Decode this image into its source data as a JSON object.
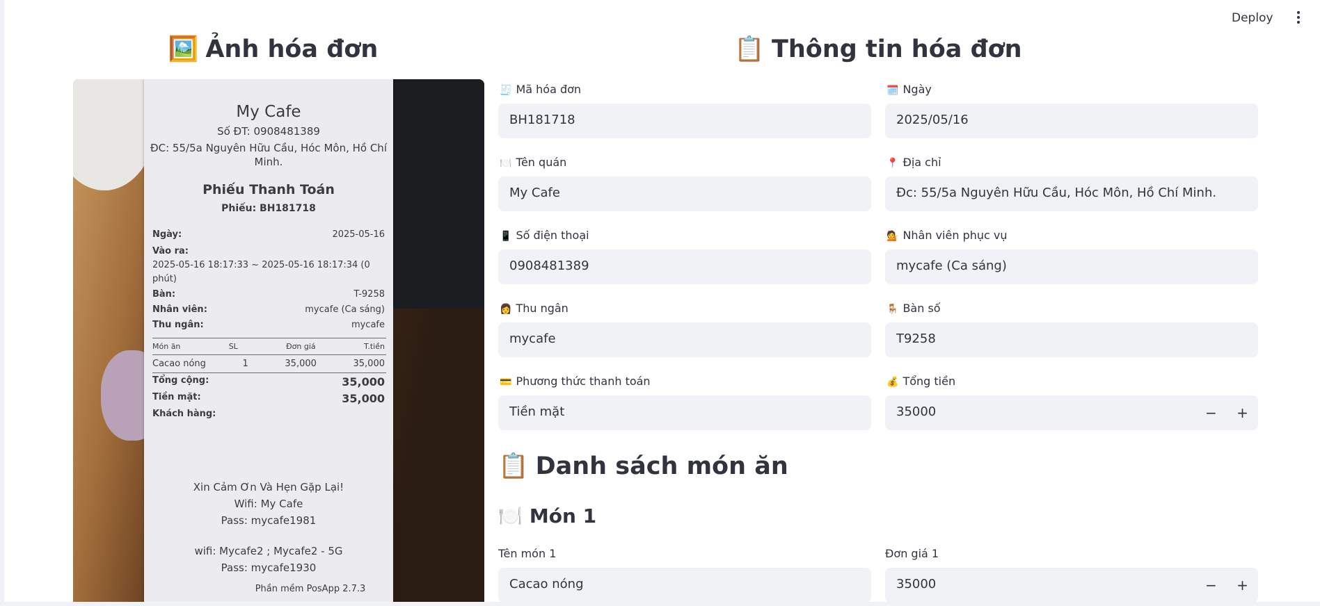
{
  "topbar": {
    "deploy_label": "Deploy",
    "menu_icon": "more-vertical-icon"
  },
  "left": {
    "heading_emoji": "🖼️",
    "heading": "Ảnh hóa đơn",
    "receipt": {
      "shop": "My Cafe",
      "phone": "Số ĐT: 0908481389",
      "address_1": "ĐC: 55/5a Nguyên Hữu Cầu, Hóc Môn, Hồ Chí",
      "address_2": "Minh.",
      "title": "Phiếu Thanh Toán",
      "code": "Phiếu: BH181718",
      "date_label": "Ngày:",
      "date_value": "2025-05-16",
      "inout_label": "Vào ra:",
      "inout_1": "2025-05-16 18:17:33 ~ 2025-05-16 18:17:34 (0",
      "inout_2": "phút)",
      "table_label": "Bàn:",
      "table_value": "T-9258",
      "staff_label": "Nhân viên:",
      "staff_value": "mycafe (Ca sáng)",
      "cashier_label": "Thu ngân:",
      "cashier_value": "mycafe",
      "col_item": "Món ăn",
      "col_qty": "SL",
      "col_price": "Đơn giá",
      "col_total": "T.tiền",
      "item_name": "Cacao nóng",
      "item_qty": "1",
      "item_price": "35,000",
      "item_total": "35,000",
      "sum_label": "Tổng cộng:",
      "sum_value": "35,000",
      "cash_label": "Tiền mặt:",
      "cash_value": "35,000",
      "customer_label": "Khách hàng:",
      "thanks": "Xin Cảm Ơn Và Hẹn Gặp Lại!",
      "wifi_1": "Wifi: My Cafe",
      "pass_1": "Pass: mycafe1981",
      "wifi_2": "wifi: Mycafe2 ; Mycafe2 - 5G",
      "pass_2": "Pass: mycafe1930",
      "software": "Phần mềm PosApp 2.7.3"
    }
  },
  "right": {
    "heading_emoji": "📋",
    "heading": "Thông tin hóa đơn",
    "fields": {
      "invoice_code": {
        "emoji": "🧾",
        "label": "Mã hóa đơn",
        "value": "BH181718"
      },
      "date": {
        "emoji": "🗓️",
        "label": "Ngày",
        "value": "2025/05/16"
      },
      "shop_name": {
        "emoji": "🍽️",
        "label": "Tên quán",
        "value": "My Cafe"
      },
      "address": {
        "emoji": "📍",
        "label": "Địa chỉ",
        "value": "Đc: 55/5a Nguyên Hữu Cầu, Hóc Môn, Hồ Chí Minh."
      },
      "phone": {
        "emoji": "📱",
        "label": "Số điện thoại",
        "value": "0908481389"
      },
      "staff": {
        "emoji": "💁",
        "label": "Nhân viên phục vụ",
        "value": "mycafe (Ca sáng)"
      },
      "cashier": {
        "emoji": "👩",
        "label": "Thu ngân",
        "value": "mycafe"
      },
      "table": {
        "emoji": "🪑",
        "label": "Bàn số",
        "value": "T9258"
      },
      "payment": {
        "emoji": "💳",
        "label": "Phương thức thanh toán",
        "value": "Tiền mặt"
      },
      "total": {
        "emoji": "💰",
        "label": "Tổng tiền",
        "value": "35000"
      }
    },
    "items_heading_emoji": "📋",
    "items_heading": "Danh sách món ăn",
    "item1": {
      "heading_emoji": "🍽️",
      "heading": "Món 1",
      "name_label": "Tên món 1",
      "name_value": "Cacao nóng",
      "price_label": "Đơn giá 1",
      "price_value": "35000"
    },
    "stepper": {
      "minus": "−",
      "plus": "+"
    }
  }
}
